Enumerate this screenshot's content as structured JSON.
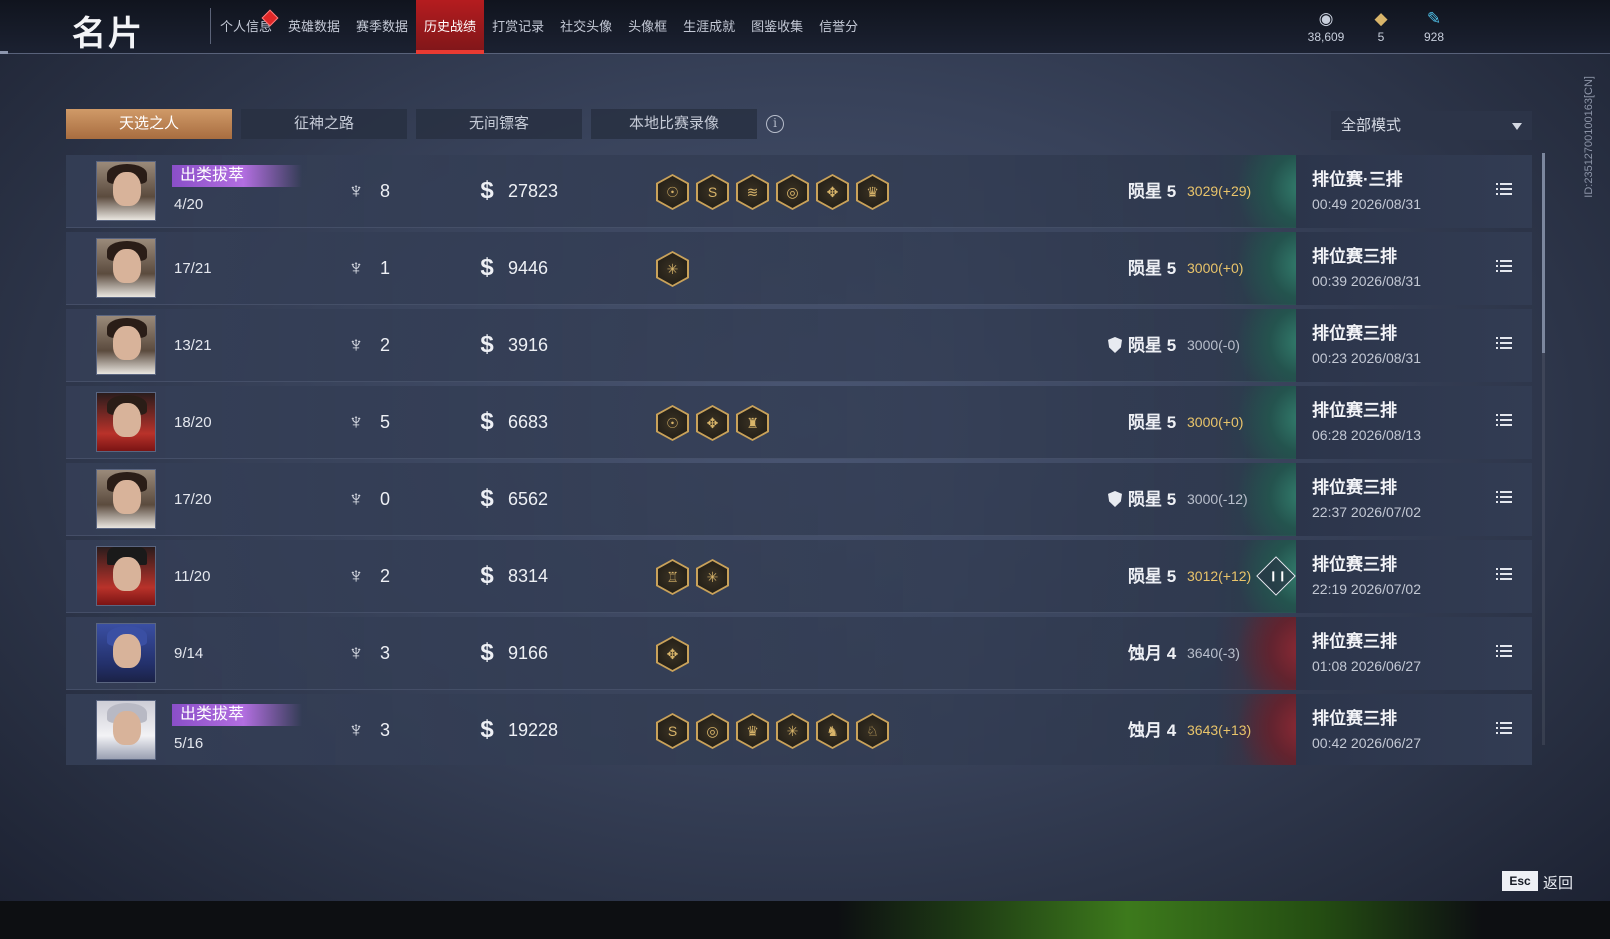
{
  "app_title": "名片",
  "nav": [
    {
      "label": "个人信息",
      "active": false,
      "badge": true
    },
    {
      "label": "英雄数据",
      "active": false
    },
    {
      "label": "赛季数据",
      "active": false
    },
    {
      "label": "历史战绩",
      "active": true
    },
    {
      "label": "打赏记录",
      "active": false
    },
    {
      "label": "社交头像",
      "active": false
    },
    {
      "label": "头像框",
      "active": false
    },
    {
      "label": "生涯成就",
      "active": false
    },
    {
      "label": "图鉴收集",
      "active": false
    },
    {
      "label": "信誉分",
      "active": false
    }
  ],
  "currencies": [
    {
      "icon": "coin-icon",
      "value": "38,609"
    },
    {
      "icon": "ticket-icon",
      "value": "5"
    },
    {
      "icon": "feather-icon",
      "value": "928"
    }
  ],
  "player_id": "ID:2351270010016​3[CN]",
  "tabs": [
    {
      "label": "天选之人",
      "active": true
    },
    {
      "label": "征神之路",
      "active": false
    },
    {
      "label": "无间镖客",
      "active": false
    },
    {
      "label": "本地比赛录像",
      "active": false
    }
  ],
  "mode_filter": "全部模式",
  "matches": [
    {
      "avatar": "hero-beard",
      "title_tag": "出类拔萃",
      "rank": "4/20",
      "kills": "8",
      "damage": "27823",
      "badges": [
        "☉",
        "S",
        "≋",
        "◎",
        "✥",
        "♛"
      ],
      "shield": false,
      "tier": "陨星 5",
      "score": "3029(+29)",
      "score_color": "gold",
      "emblem": "jade",
      "stats": false,
      "mode": "排位赛·三排",
      "time": "00:49  2026/08/31"
    },
    {
      "avatar": "hero-youth",
      "title_tag": "",
      "rank": "17/21",
      "kills": "1",
      "damage": "9446",
      "badges": [
        "✳"
      ],
      "shield": false,
      "tier": "陨星 5",
      "score": "3000(+0)",
      "score_color": "gold",
      "emblem": "jade",
      "stats": false,
      "mode": "排位赛三排",
      "time": "00:39  2026/08/31"
    },
    {
      "avatar": "hero-youth",
      "title_tag": "",
      "rank": "13/21",
      "kills": "2",
      "damage": "3916",
      "badges": [],
      "shield": true,
      "tier": "陨星 5",
      "score": "3000(-0)",
      "score_color": "grey",
      "emblem": "jade",
      "stats": false,
      "mode": "排位赛三排",
      "time": "00:23  2026/08/31"
    },
    {
      "avatar": "hero-red",
      "title_tag": "",
      "rank": "18/20",
      "kills": "5",
      "damage": "6683",
      "badges": [
        "☉",
        "✥",
        "♜"
      ],
      "shield": false,
      "tier": "陨星 5",
      "score": "3000(+0)",
      "score_color": "gold",
      "emblem": "jade",
      "stats": false,
      "mode": "排位赛三排",
      "time": "06:28  2026/08/13"
    },
    {
      "avatar": "hero-youth",
      "title_tag": "",
      "rank": "17/20",
      "kills": "0",
      "damage": "6562",
      "badges": [],
      "shield": true,
      "tier": "陨星 5",
      "score": "3000(-12)",
      "score_color": "grey",
      "emblem": "jade",
      "stats": false,
      "mode": "排位赛三排",
      "time": "22:37  2026/07/02"
    },
    {
      "avatar": "hero-hat",
      "title_tag": "",
      "rank": "11/20",
      "kills": "2",
      "damage": "8314",
      "badges": [
        "♖",
        "✳"
      ],
      "shield": false,
      "tier": "陨星 5",
      "score": "3012(+12)",
      "score_color": "gold",
      "emblem": "jade",
      "stats": true,
      "mode": "排位赛三排",
      "time": "22:19  2026/07/02"
    },
    {
      "avatar": "hero-hood",
      "title_tag": "",
      "rank": "9/14",
      "kills": "3",
      "damage": "9166",
      "badges": [
        "✥"
      ],
      "shield": false,
      "tier": "蚀月 4",
      "score": "3640(-3)",
      "score_color": "grey",
      "emblem": "crimson",
      "stats": false,
      "mode": "排位赛三排",
      "time": "01:08  2026/06/27"
    },
    {
      "avatar": "hero-veil",
      "title_tag": "出类拔萃",
      "rank": "5/16",
      "kills": "3",
      "damage": "19228",
      "badges": [
        "S",
        "◎",
        "♛",
        "✳",
        "♞",
        "♘"
      ],
      "shield": false,
      "tier": "蚀月 4",
      "score": "3643(+13)",
      "score_color": "gold",
      "emblem": "crimson",
      "stats": false,
      "mode": "排位赛三排",
      "time": "00:42  2026/06/27"
    }
  ],
  "footer": {
    "key": "Esc",
    "label": "返回"
  }
}
